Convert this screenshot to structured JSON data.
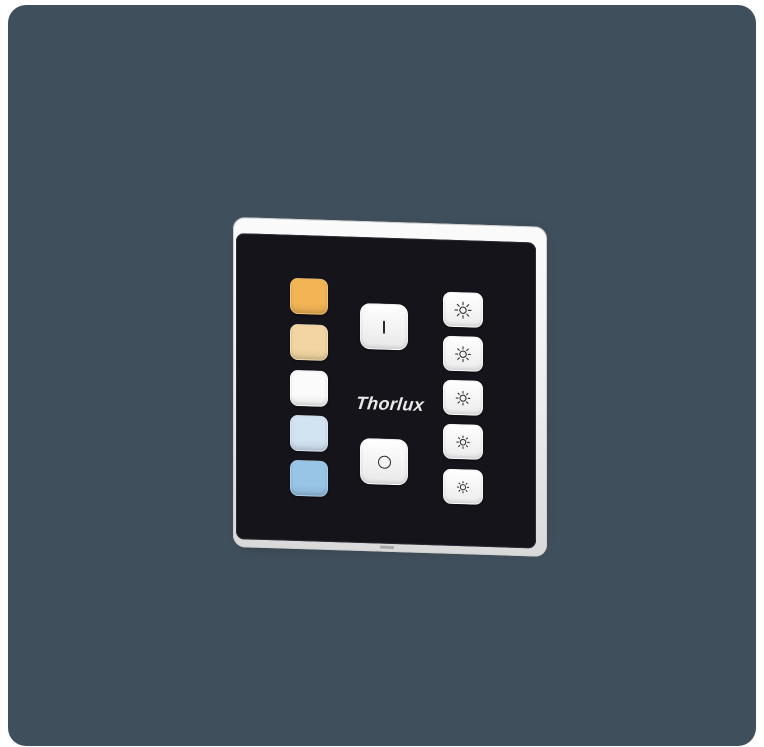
{
  "product": {
    "brand_logo": "Thorlux",
    "type": "wall lighting control keypad"
  },
  "controls": {
    "colour_buttons": [
      {
        "color": "#f2b455"
      },
      {
        "color": "#f2d5a2"
      },
      {
        "color": "#fbfbfb"
      },
      {
        "color": "#d2e3f1"
      },
      {
        "color": "#98c4e6"
      }
    ],
    "on_button_icon": "power-on-line-icon",
    "off_button_icon": "power-off-circle-icon",
    "brightness_buttons": [
      {
        "icon": "sun-icon",
        "level": 5
      },
      {
        "icon": "sun-icon",
        "level": 4
      },
      {
        "icon": "sun-icon",
        "level": 3
      },
      {
        "icon": "sun-icon",
        "level": 2
      },
      {
        "icon": "sun-icon",
        "level": 1
      }
    ]
  },
  "colors": {
    "background": "#404f5c",
    "faceplate": "#15141b",
    "housing": "#ececec"
  }
}
